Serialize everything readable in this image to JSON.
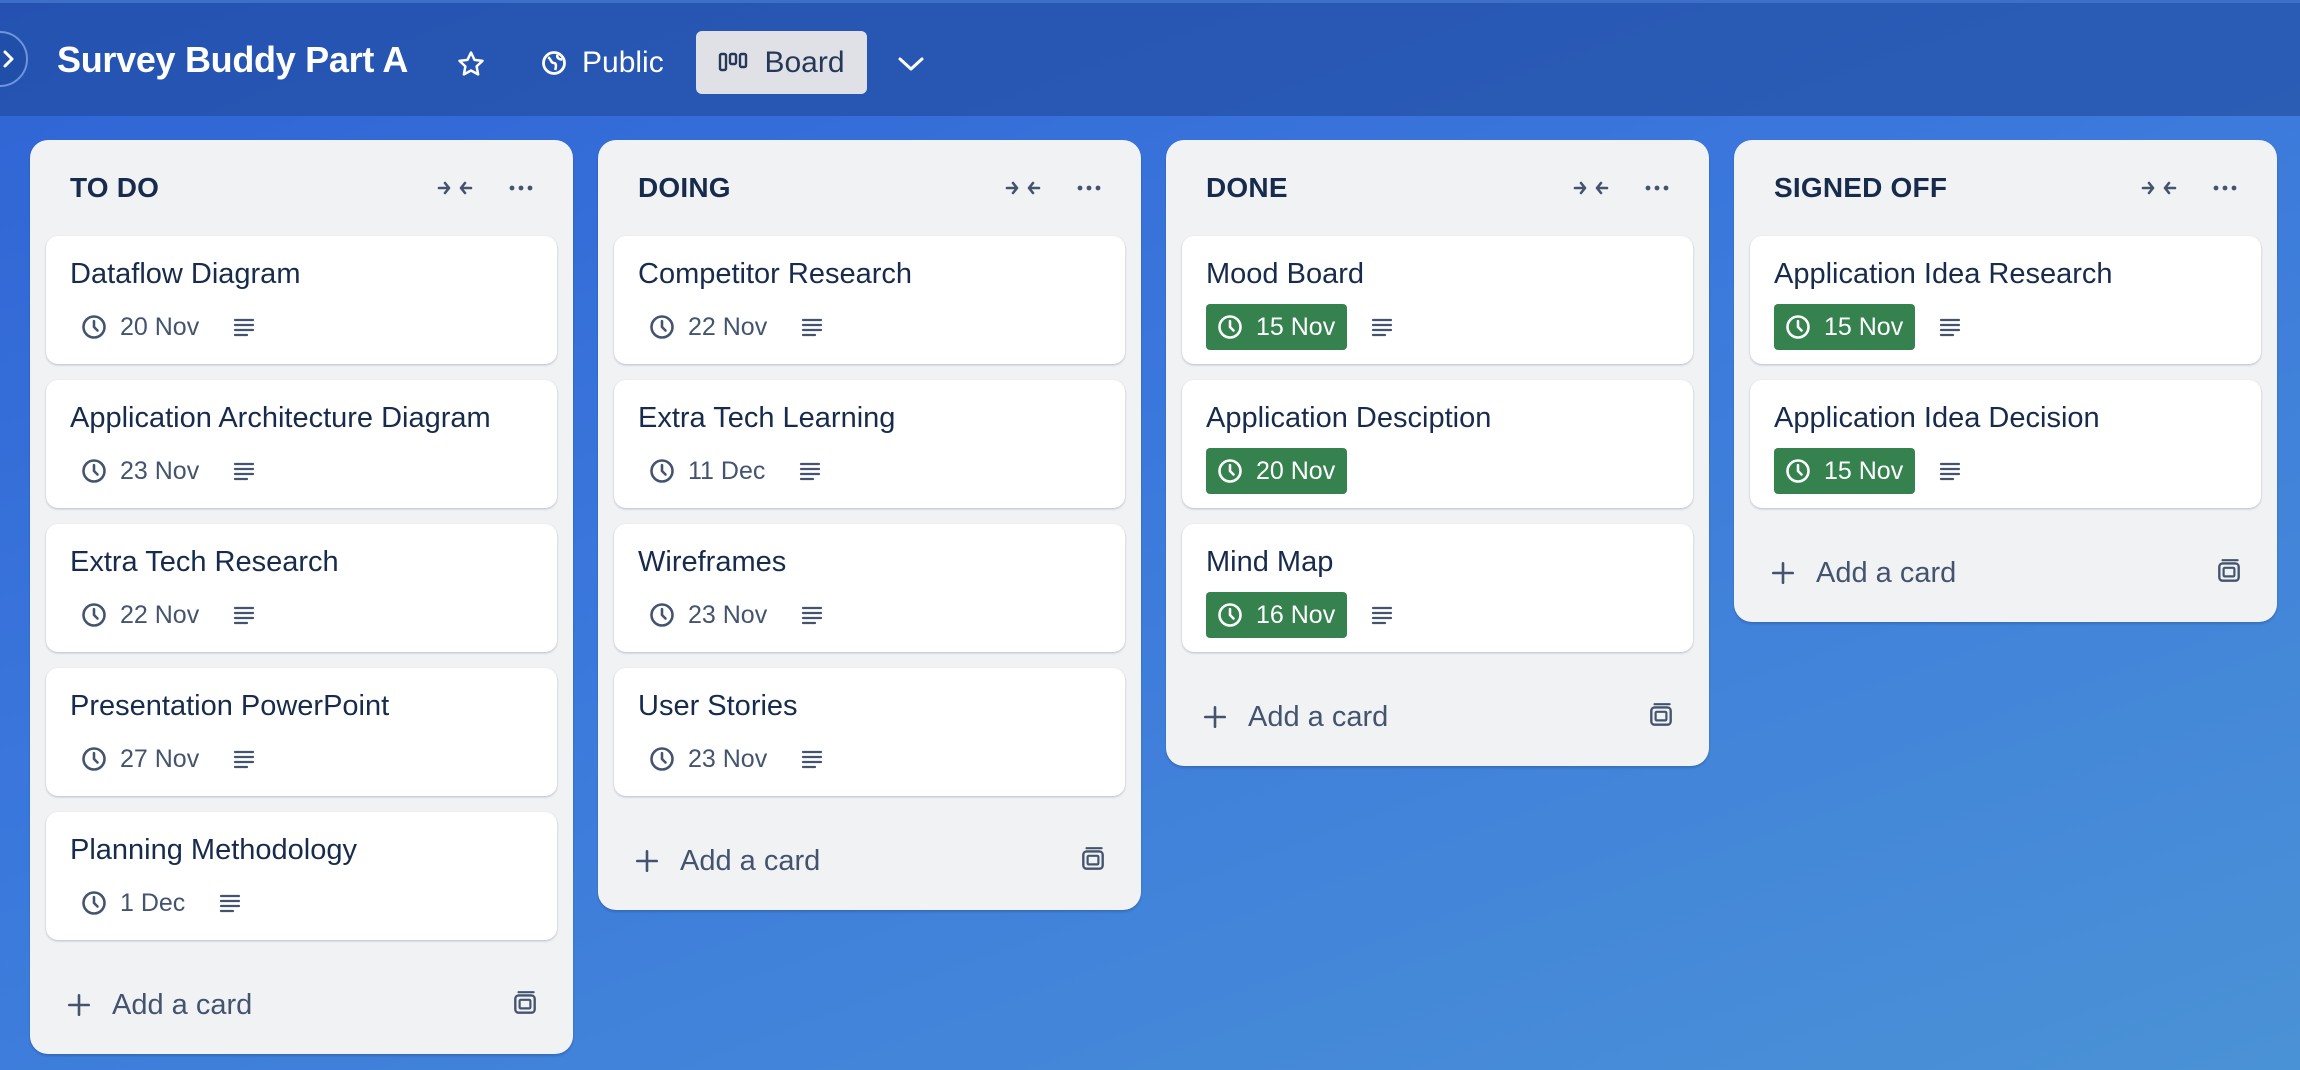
{
  "board": {
    "title": "Survey Buddy Part A",
    "visibility": "Public",
    "view": "Board"
  },
  "colors": {
    "due_done_bg": "#35824f",
    "list_bg": "#f1f2f4",
    "header_bg": "#2a55ad"
  },
  "lists": [
    {
      "title": "TO DO",
      "add_label": "Add a card",
      "cards": [
        {
          "title": "Dataflow Diagram",
          "due": "20 Nov",
          "complete": false
        },
        {
          "title": "Application Architecture Diagram",
          "due": "23 Nov",
          "complete": false
        },
        {
          "title": "Extra Tech Research",
          "due": "22 Nov",
          "complete": false
        },
        {
          "title": "Presentation PowerPoint",
          "due": "27 Nov",
          "complete": false
        },
        {
          "title": "Planning Methodology",
          "due": "1 Dec",
          "complete": false
        }
      ]
    },
    {
      "title": "DOING",
      "add_label": "Add a card",
      "cards": [
        {
          "title": "Competitor Research",
          "due": "22 Nov",
          "complete": false
        },
        {
          "title": "Extra Tech Learning",
          "due": "11 Dec",
          "complete": false
        },
        {
          "title": "Wireframes",
          "due": "23 Nov",
          "complete": false
        },
        {
          "title": "User Stories",
          "due": "23 Nov",
          "complete": false
        }
      ]
    },
    {
      "title": "DONE",
      "add_label": "Add a card",
      "cards": [
        {
          "title": "Mood Board",
          "due": "15 Nov",
          "complete": true,
          "has_description": true
        },
        {
          "title": "Application Desciption",
          "due": "20 Nov",
          "complete": true,
          "has_description": false
        },
        {
          "title": "Mind Map",
          "due": "16 Nov",
          "complete": true,
          "has_description": true
        }
      ]
    },
    {
      "title": "SIGNED OFF",
      "add_label": "Add a card",
      "cards": [
        {
          "title": "Application Idea Research",
          "due": "15 Nov",
          "complete": true
        },
        {
          "title": "Application Idea Decision",
          "due": "15 Nov",
          "complete": true
        }
      ]
    }
  ]
}
